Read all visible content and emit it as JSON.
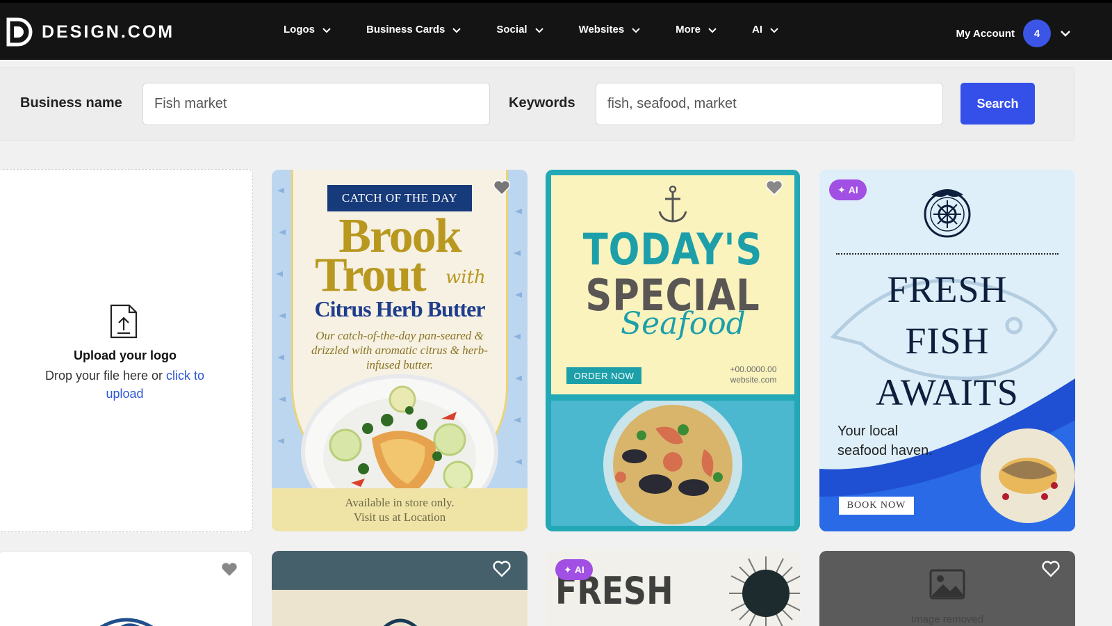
{
  "brand": {
    "name": "DESIGN.COM"
  },
  "nav": {
    "items": [
      {
        "label": "Logos"
      },
      {
        "label": "Business Cards"
      },
      {
        "label": "Social"
      },
      {
        "label": "Websites"
      },
      {
        "label": "More"
      },
      {
        "label": "AI"
      }
    ],
    "account_label": "My Account",
    "account_badge": "4"
  },
  "search": {
    "business_label": "Business name",
    "business_value": "Fish market",
    "keywords_label": "Keywords",
    "keywords_value": "fish, seafood, market",
    "button": "Search"
  },
  "upload": {
    "title": "Upload your logo",
    "text": "Drop your file here or ",
    "link": "click to upload"
  },
  "cards": {
    "trout": {
      "banner": "CATCH OF THE DAY",
      "line1": "Brook",
      "line2": "Trout",
      "with": "with",
      "line3": "Citrus Herb Butter",
      "desc": "Our catch-of-the-day pan-seared & drizzled with aromatic citrus & herb-infused butter.",
      "footer1": "Available in store only.",
      "footer2": "Visit us at Location"
    },
    "special": {
      "line1": "TODAY'S",
      "line2": "SPECIAL",
      "script": "Seafood",
      "order": "ORDER NOW",
      "phone": "+00.0000.00",
      "site": "website.com"
    },
    "fresh": {
      "badge": "AI",
      "title1": "FRESH",
      "title2": "FISH",
      "title3": "AWAITS",
      "sub1": "Your local",
      "sub2": "seafood haven.",
      "book": "BOOK NOW"
    },
    "fresh2": {
      "badge": "AI",
      "title": "FRESH"
    },
    "removed": {
      "text": "Image removed"
    }
  },
  "colors": {
    "topbar": "#141414",
    "accent": "#3550e8",
    "ai_badge": "#a24fe3",
    "teal": "#1d9faa",
    "gold": "#b99820"
  }
}
